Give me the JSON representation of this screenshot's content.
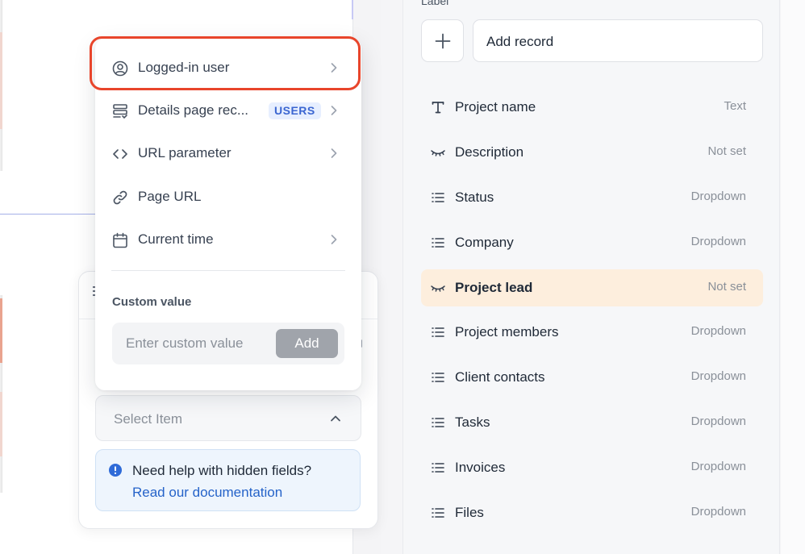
{
  "dropdown": {
    "options": [
      {
        "label": "Logged-in user",
        "icon": "user-circle-icon",
        "has_submenu": true
      },
      {
        "label": "Details page rec...",
        "icon": "record-list-icon",
        "has_submenu": true,
        "badge": "USERS"
      },
      {
        "label": "URL parameter",
        "icon": "code-brackets-icon",
        "has_submenu": true
      },
      {
        "label": "Page URL",
        "icon": "link-icon",
        "has_submenu": false
      },
      {
        "label": "Current time",
        "icon": "calendar-icon",
        "has_submenu": true
      }
    ],
    "custom_value": {
      "title": "Custom value",
      "placeholder": "Enter custom value",
      "add_label": "Add"
    }
  },
  "select": {
    "placeholder": "Select Item"
  },
  "help": {
    "text": "Need help with hidden fields?",
    "link": "Read our documentation"
  },
  "sidebar": {
    "label": "Label",
    "add_record_label": "Add record",
    "fields": [
      {
        "name": "Project name",
        "type": "Text",
        "icon": "text-type-icon"
      },
      {
        "name": "Description",
        "type": "Not set",
        "icon": "hidden-eye-icon"
      },
      {
        "name": "Status",
        "type": "Dropdown",
        "icon": "list-icon"
      },
      {
        "name": "Company",
        "type": "Dropdown",
        "icon": "list-icon"
      },
      {
        "name": "Project lead",
        "type": "Not set",
        "icon": "hidden-eye-icon",
        "selected": true
      },
      {
        "name": "Project members",
        "type": "Dropdown",
        "icon": "list-icon"
      },
      {
        "name": "Client contacts",
        "type": "Dropdown",
        "icon": "list-icon"
      },
      {
        "name": "Tasks",
        "type": "Dropdown",
        "icon": "list-icon"
      },
      {
        "name": "Invoices",
        "type": "Dropdown",
        "icon": "list-icon"
      },
      {
        "name": "Files",
        "type": "Dropdown",
        "icon": "list-icon"
      }
    ]
  },
  "colors": {
    "highlight_ring": "#e8452b",
    "selected_row": "#fdeedd",
    "badge_text": "#3b66d1",
    "link": "#2563c9",
    "help_alert": "#2f6bd8"
  }
}
